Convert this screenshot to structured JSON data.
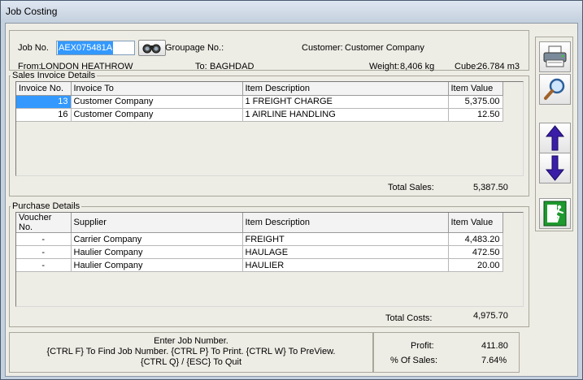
{
  "window": {
    "title": "Job Costing"
  },
  "header": {
    "job_no_label": "Job No.",
    "job_no_value": "AEX075481A",
    "groupage_label": "Groupage No.:",
    "customer_label": "Customer:",
    "customer_value": "Customer Company",
    "from_label": "From:",
    "from_value": "LONDON HEATHROW",
    "to_label": "To:",
    "to_value": "BAGHDAD",
    "weight_label": "Weight:",
    "weight_value": "8,406 kg",
    "cube_label": "Cube:",
    "cube_value": "26.784 m3"
  },
  "sales": {
    "group_title": "Sales Invoice Details",
    "columns": [
      "Invoice No.",
      "Invoice To",
      "Item Description",
      "Item Value"
    ],
    "rows": [
      {
        "invoice_no": "13",
        "invoice_to": "Customer Company",
        "description": "1 FREIGHT CHARGE",
        "value": "5,375.00"
      },
      {
        "invoice_no": "16",
        "invoice_to": "Customer Company",
        "description": "1 AIRLINE HANDLING",
        "value": "12.50"
      }
    ],
    "total_label": "Total Sales:",
    "total_value": "5,387.50"
  },
  "purchases": {
    "group_title": "Purchase Details",
    "columns": [
      "Voucher No.",
      "Supplier",
      "Item Description",
      "Item Value"
    ],
    "rows": [
      {
        "voucher_no": "-",
        "supplier": "Carrier Company",
        "description": "FREIGHT",
        "value": "4,483.20"
      },
      {
        "voucher_no": "-",
        "supplier": "Haulier Company",
        "description": "HAULAGE",
        "value": "472.50"
      },
      {
        "voucher_no": "-",
        "supplier": "Haulier Company",
        "description": "HAULIER",
        "value": "20.00"
      }
    ],
    "total_label": "Total Costs:",
    "total_value": "4,975.70"
  },
  "footer": {
    "hint_line1": "Enter Job Number.",
    "hint_line2": "{CTRL F} To Find Job Number.  {CTRL P} To Print.  {CTRL W} To PreView.",
    "hint_line3": "{CTRL Q} / {ESC} To Quit",
    "profit_label": "Profit:",
    "profit_value": "411.80",
    "pct_label": "% Of Sales:",
    "pct_value": "7.64%"
  },
  "toolbar": {
    "icons": [
      "printer-icon",
      "magnifier-icon",
      "arrow-up-icon",
      "arrow-down-icon",
      "exit-icon"
    ]
  },
  "colors": {
    "selection": "#3399ff",
    "arrow": "#3a1ea8",
    "exit_green": "#1e9a2e"
  }
}
